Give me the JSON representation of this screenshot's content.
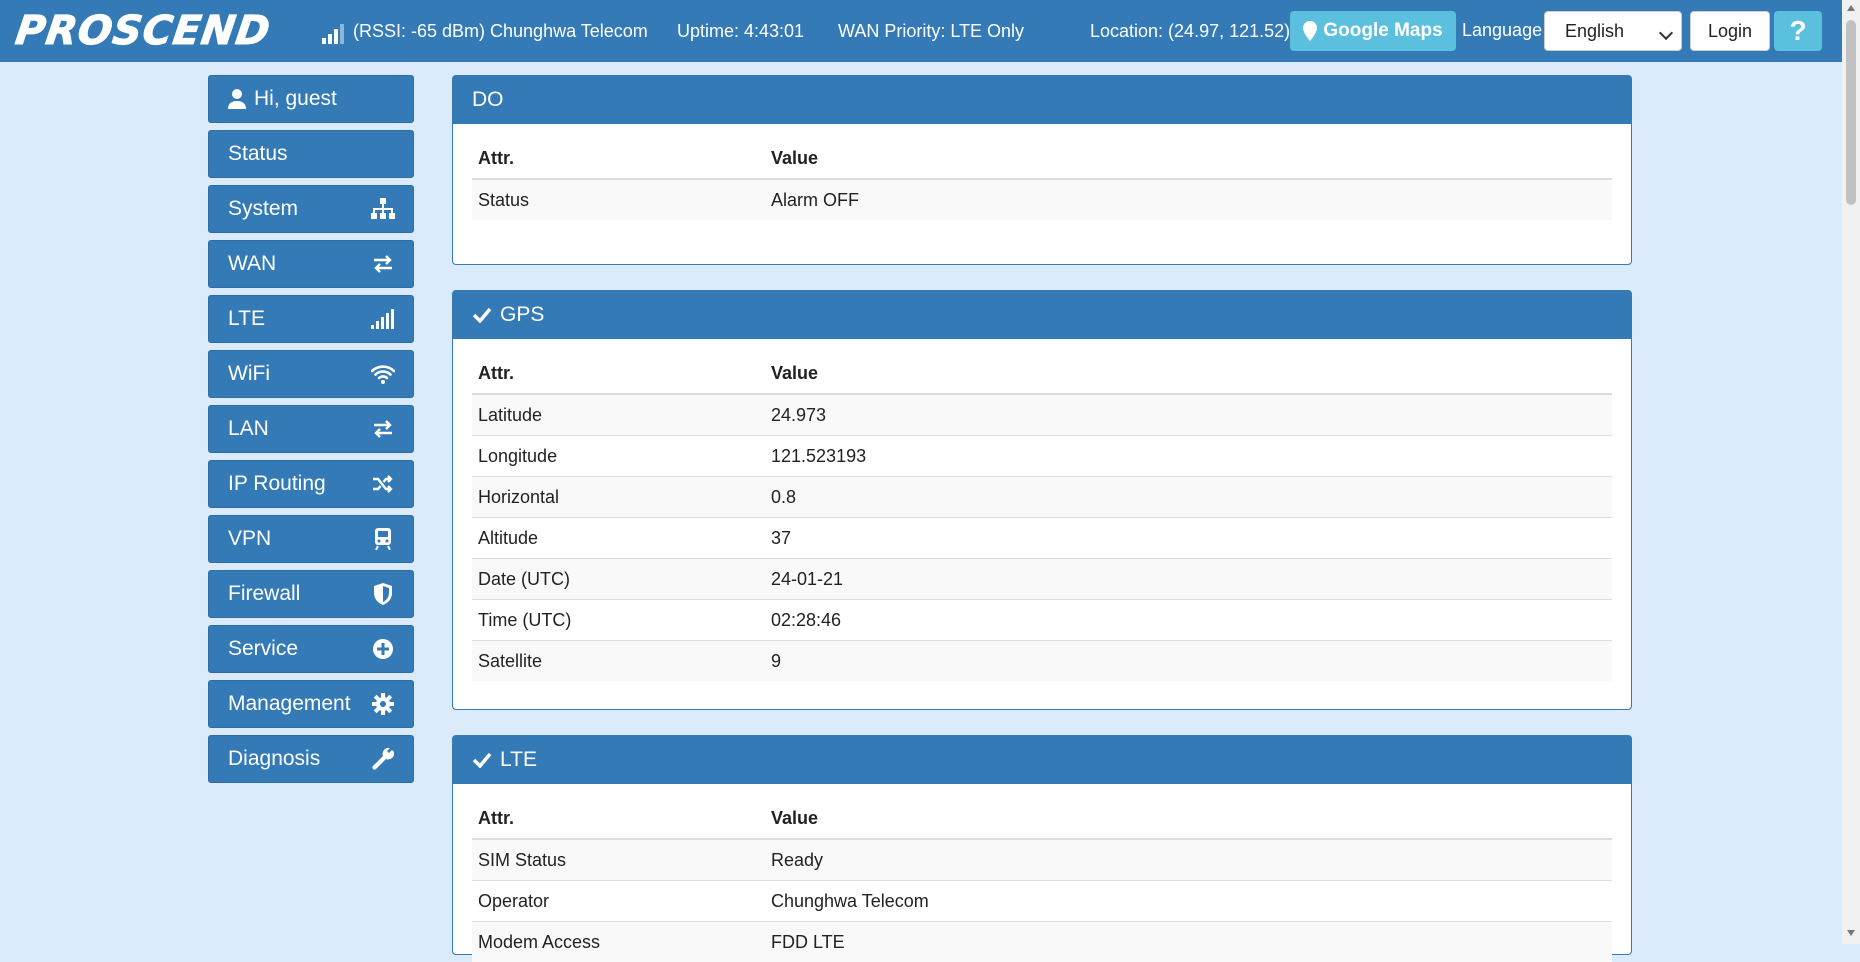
{
  "header": {
    "brand": "PROSCEND",
    "signal_text": "(RSSI: -65 dBm) Chunghwa Telecom",
    "uptime": "Uptime: 4:43:01",
    "wan_priority": "WAN Priority: LTE Only",
    "location": "Location: (24.97, 121.52)",
    "maps_button": "Google Maps",
    "language_label": "Language",
    "language_selected": "English",
    "login_button": "Login",
    "help_button": "?"
  },
  "sidebar": {
    "greeting": "Hi, guest",
    "items": [
      {
        "label": "Status",
        "icon": ""
      },
      {
        "label": "System",
        "icon": "sitemap-icon"
      },
      {
        "label": "WAN",
        "icon": "exchange-icon"
      },
      {
        "label": "LTE",
        "icon": "signal-bars-icon"
      },
      {
        "label": "WiFi",
        "icon": "wifi-icon"
      },
      {
        "label": "LAN",
        "icon": "exchange-icon"
      },
      {
        "label": "IP Routing",
        "icon": "shuffle-icon"
      },
      {
        "label": "VPN",
        "icon": "train-icon"
      },
      {
        "label": "Firewall",
        "icon": "shield-icon"
      },
      {
        "label": "Service",
        "icon": "plus-circle-icon"
      },
      {
        "label": "Management",
        "icon": "gear-icon"
      },
      {
        "label": "Diagnosis",
        "icon": "wrench-icon"
      }
    ]
  },
  "panels": {
    "do": {
      "title": "DO",
      "col_attr": "Attr.",
      "col_value": "Value",
      "rows": [
        {
          "attr": "Status",
          "value": "Alarm OFF"
        }
      ]
    },
    "gps": {
      "title": "GPS",
      "col_attr": "Attr.",
      "col_value": "Value",
      "rows": [
        {
          "attr": "Latitude",
          "value": "24.973"
        },
        {
          "attr": "Longitude",
          "value": "121.523193"
        },
        {
          "attr": "Horizontal",
          "value": "0.8"
        },
        {
          "attr": "Altitude",
          "value": "37"
        },
        {
          "attr": "Date (UTC)",
          "value": "24-01-21"
        },
        {
          "attr": "Time (UTC)",
          "value": "02:28:46"
        },
        {
          "attr": "Satellite",
          "value": "9"
        }
      ]
    },
    "lte": {
      "title": "LTE",
      "col_attr": "Attr.",
      "col_value": "Value",
      "rows": [
        {
          "attr": "SIM Status",
          "value": "Ready"
        },
        {
          "attr": "Operator",
          "value": "Chunghwa Telecom"
        },
        {
          "attr": "Modem Access",
          "value": "FDD LTE"
        }
      ]
    }
  },
  "colors": {
    "primary": "#337ab7",
    "info": "#5bc0de",
    "background": "#dbebfb"
  }
}
